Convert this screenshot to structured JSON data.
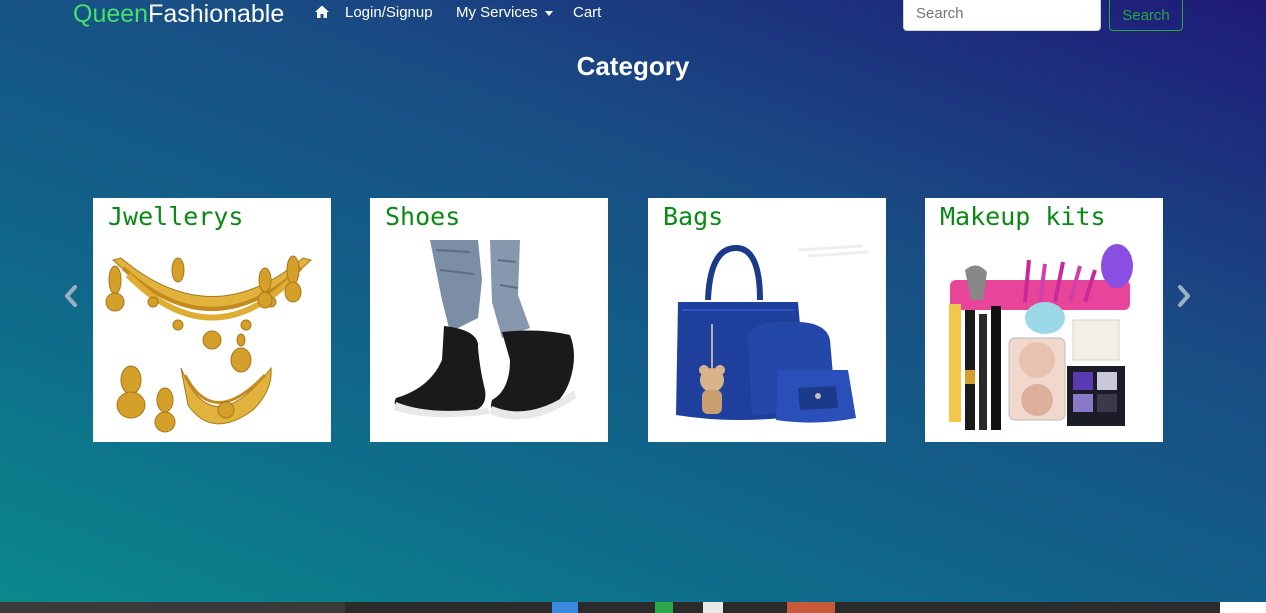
{
  "nav": {
    "brand_part1": "Queen",
    "brand_part2": "Fashionable",
    "home_icon": "home-icon",
    "links": [
      "Login/Signup",
      "My Services",
      "Cart"
    ],
    "search_placeholder": "Search",
    "search_button": "Search"
  },
  "page": {
    "title": "Category"
  },
  "categories": [
    {
      "label": "Jwellerys",
      "image": "jewellery-set"
    },
    {
      "label": "Shoes",
      "image": "black-sneakers"
    },
    {
      "label": "Bags",
      "image": "blue-handbag-set"
    },
    {
      "label": "Makeup kits",
      "image": "makeup-kit"
    }
  ],
  "carousel": {
    "prev_icon": "chevron-left-icon",
    "next_icon": "chevron-right-icon"
  },
  "colors": {
    "brand_accent": "#43e06a",
    "category_text": "#0a8a14",
    "search_outline": "#28a745"
  }
}
